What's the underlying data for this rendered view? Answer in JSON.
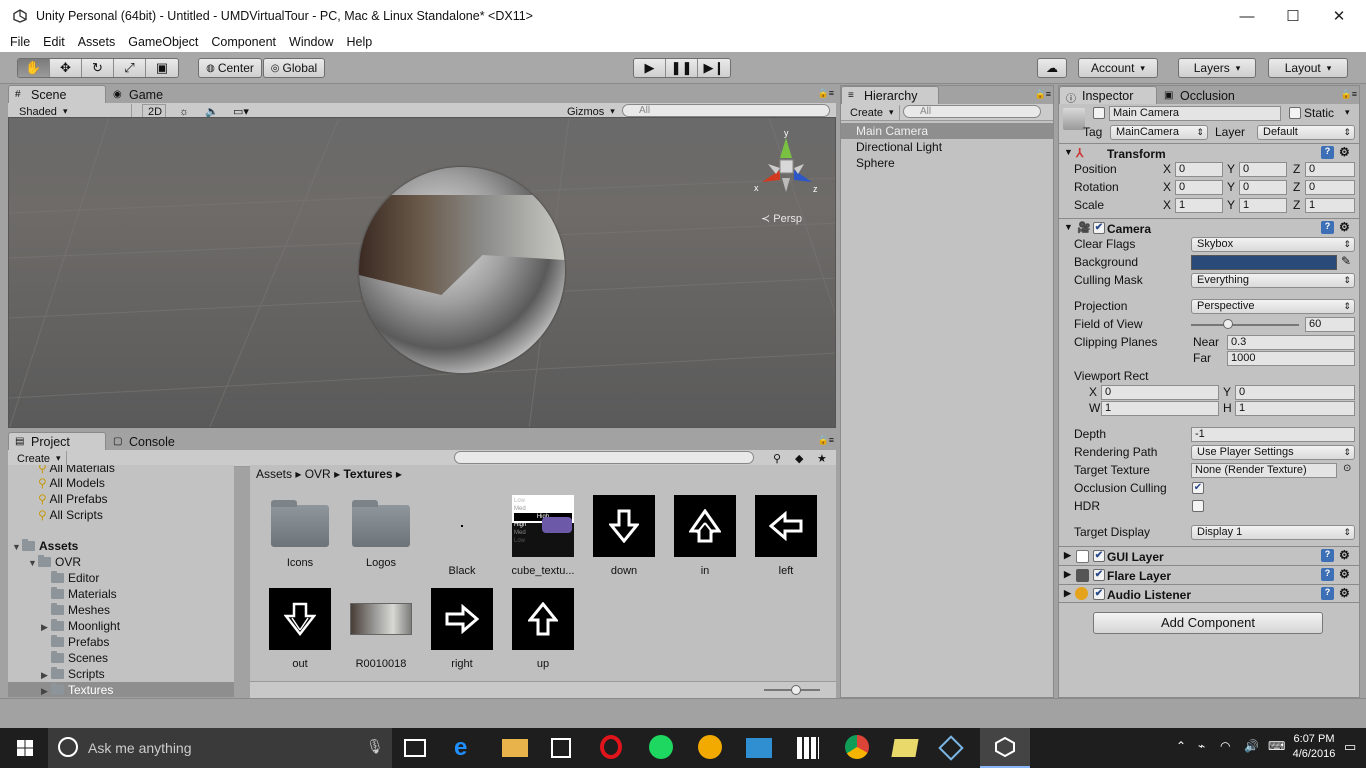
{
  "window": {
    "title": "Unity Personal (64bit) - Untitled - UMDVirtualTour - PC, Mac & Linux Standalone* <DX11>"
  },
  "menu": [
    "File",
    "Edit",
    "Assets",
    "GameObject",
    "Component",
    "Window",
    "Help"
  ],
  "toolbar": {
    "pivot": "Center",
    "space": "Global",
    "account": "Account",
    "layers": "Layers",
    "layout": "Layout"
  },
  "scene": {
    "tab_scene": "Scene",
    "tab_game": "Game",
    "shading": "Shaded",
    "mode2d": "2D",
    "gizmos": "Gizmos",
    "search_placeholder": "All",
    "persp": "Persp",
    "axis_x": "x",
    "axis_y": "y",
    "axis_z": "z"
  },
  "hierarchy": {
    "tab": "Hierarchy",
    "create": "Create",
    "search_placeholder": "All",
    "items": [
      "Main Camera",
      "Directional Light",
      "Sphere"
    ]
  },
  "project": {
    "tab": "Project",
    "console_tab": "Console",
    "create": "Create",
    "tree": {
      "all_materials": "All Materials",
      "all_models": "All Models",
      "all_prefabs": "All Prefabs",
      "all_scripts": "All Scripts",
      "assets": "Assets",
      "ovr": "OVR",
      "editor": "Editor",
      "materials": "Materials",
      "meshes": "Meshes",
      "moonlight": "Moonlight",
      "prefabs": "Prefabs",
      "scenes": "Scenes",
      "scripts": "Scripts",
      "textures": "Textures"
    },
    "breadcrumb": [
      "Assets",
      "OVR",
      "Textures"
    ],
    "assets": [
      "Icons",
      "Logos",
      "Black",
      "cube_textu...",
      "down",
      "in",
      "left",
      "out",
      "R0010018",
      "right",
      "up"
    ],
    "thumb_text": [
      "Low",
      "Med",
      "High",
      "High",
      "Med",
      "Low"
    ]
  },
  "inspector": {
    "tab": "Inspector",
    "occlusion_tab": "Occlusion",
    "name": "Main Camera",
    "static": "Static",
    "tag_label": "Tag",
    "tag": "MainCamera",
    "layer_label": "Layer",
    "layer": "Default",
    "transform": {
      "title": "Transform",
      "position": "Position",
      "rotation": "Rotation",
      "scale": "Scale",
      "px": "0",
      "py": "0",
      "pz": "0",
      "rx": "0",
      "ry": "0",
      "rz": "0",
      "sx": "1",
      "sy": "1",
      "sz": "1",
      "X": "X",
      "Y": "Y",
      "Z": "Z"
    },
    "camera": {
      "title": "Camera",
      "clear_flags_label": "Clear Flags",
      "clear_flags": "Skybox",
      "background_label": "Background",
      "background_color": "#2a4a7a",
      "culling_mask_label": "Culling Mask",
      "culling_mask": "Everything",
      "projection_label": "Projection",
      "projection": "Perspective",
      "fov_label": "Field of View",
      "fov": "60",
      "clipping_label": "Clipping Planes",
      "near_label": "Near",
      "near": "0.3",
      "far_label": "Far",
      "far": "1000",
      "viewport_label": "Viewport Rect",
      "vx_label": "X",
      "vx": "0",
      "vy_label": "Y",
      "vy": "0",
      "vw_label": "W",
      "vw": "1",
      "vh_label": "H",
      "vh": "1",
      "depth_label": "Depth",
      "depth": "-1",
      "rendering_path_label": "Rendering Path",
      "rendering_path": "Use Player Settings",
      "target_texture_label": "Target Texture",
      "target_texture": "None (Render Texture)",
      "occlusion_label": "Occlusion Culling",
      "hdr_label": "HDR",
      "target_display_label": "Target Display",
      "target_display": "Display 1"
    },
    "gui_layer": "GUI Layer",
    "flare_layer": "Flare Layer",
    "audio_listener": "Audio Listener",
    "add_component": "Add Component"
  },
  "taskbar": {
    "search": "Ask me anything",
    "time": "6:07 PM",
    "date": "4/6/2016"
  }
}
